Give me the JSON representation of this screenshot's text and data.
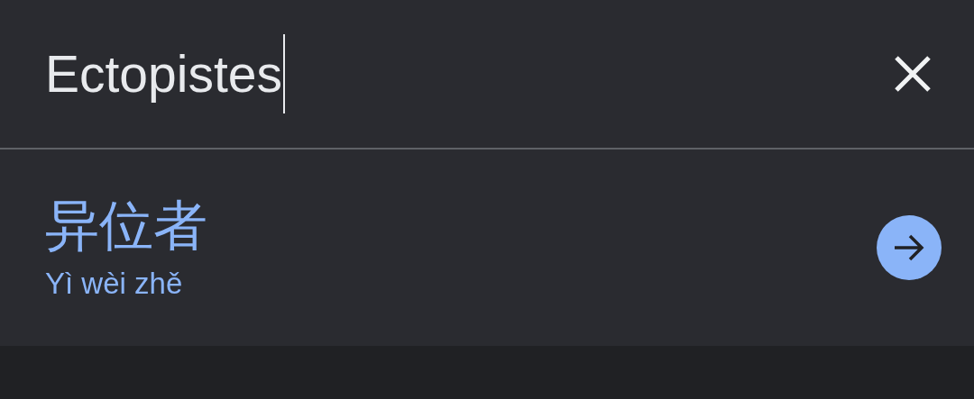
{
  "search": {
    "value": "Ectopistes"
  },
  "result": {
    "translation": "异位者",
    "pinyin": "Yì wèi zhě"
  }
}
